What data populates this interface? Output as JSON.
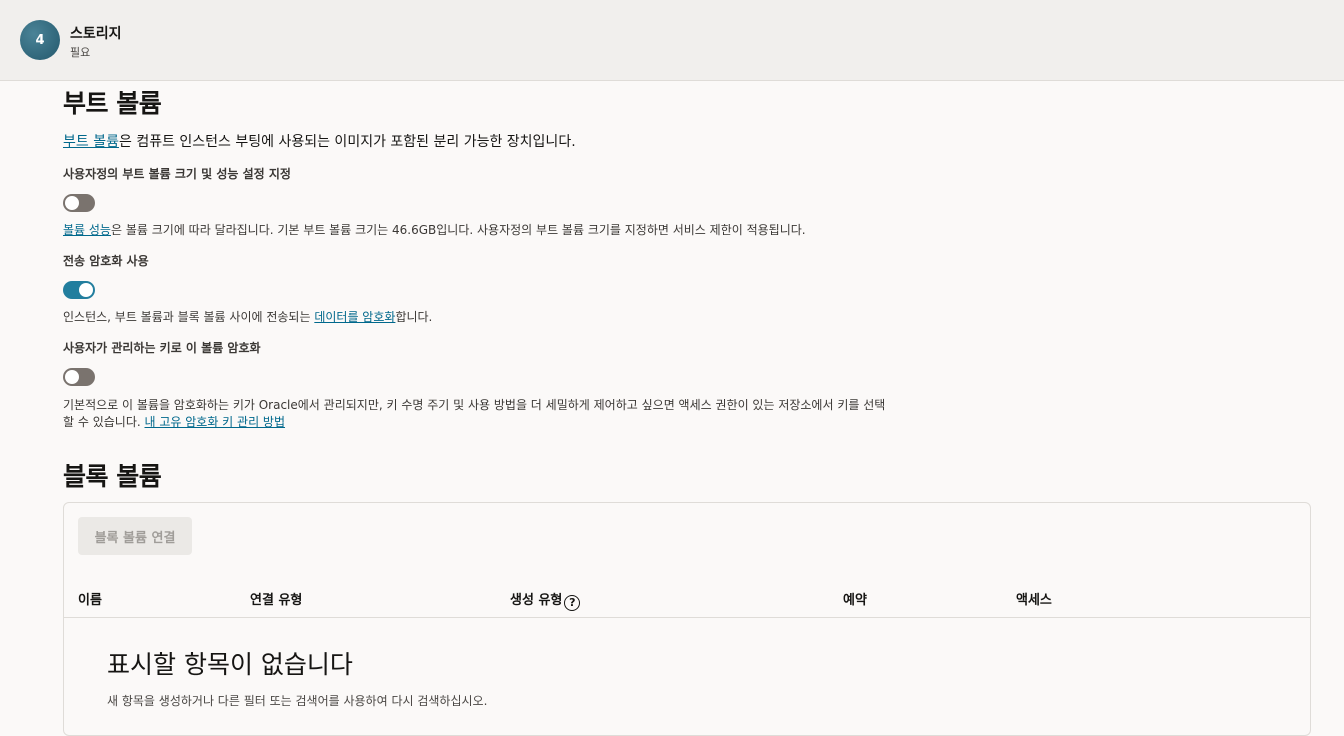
{
  "step": {
    "number": "4",
    "title": "스토리지",
    "subtitle": "필요"
  },
  "boot_volume": {
    "heading": "부트 볼륨",
    "intro_link": "부트 볼륨",
    "intro_rest": "은 컴퓨트 인스턴스 부팅에 사용되는 이미지가 포함된 분리 가능한 장치입니다.",
    "custom_size": {
      "label": "사용자정의 부트 볼륨 크기 및 성능 설정 지정",
      "enabled": false,
      "help_link": "볼륨 성능",
      "help_rest": "은 볼륨 크기에 따라 달라집니다. 기본 부트 볼륨 크기는 46.6GB입니다. 사용자정의 부트 볼륨 크기를 지정하면 서비스 제한이 적용됩니다."
    },
    "in_transit": {
      "label": "전송 암호화 사용",
      "enabled": true,
      "help_pre": "인스턴스, 부트 볼륨과 블록 볼륨 사이에 전송되는 ",
      "help_link": "데이터를 암호화",
      "help_post": "합니다."
    },
    "customer_key": {
      "label": "사용자가 관리하는 키로 이 볼륨 암호화",
      "enabled": false,
      "help_line1": "기본적으로 이 볼륨을 암호화하는 키가 Oracle에서 관리되지만, 키 수명 주기 및 사용 방법을 더 세밀하게 제어하고 싶으면 액세스 권한이 있는 저장소에서 키를 선택",
      "help_line2": "할 수 있습니다. ",
      "help_link": "내 고유 암호화 키 관리 방법"
    }
  },
  "block_volume": {
    "heading": "블록 볼륨",
    "attach_button": "블록 볼륨 연결",
    "columns": [
      "이름",
      "연결 유형",
      "생성 유형",
      "예약",
      "액세스"
    ],
    "help_icon": "question-circle-icon",
    "empty_title": "표시할 항목이 없습니다",
    "empty_sub": "새 항목을 생성하거나 다른 필터 또는 검색어를 사용하여 다시 검색하십시오."
  },
  "colors": {
    "accent": "#227e9e",
    "link": "#00688c",
    "toggle_off": "#7a736e"
  }
}
